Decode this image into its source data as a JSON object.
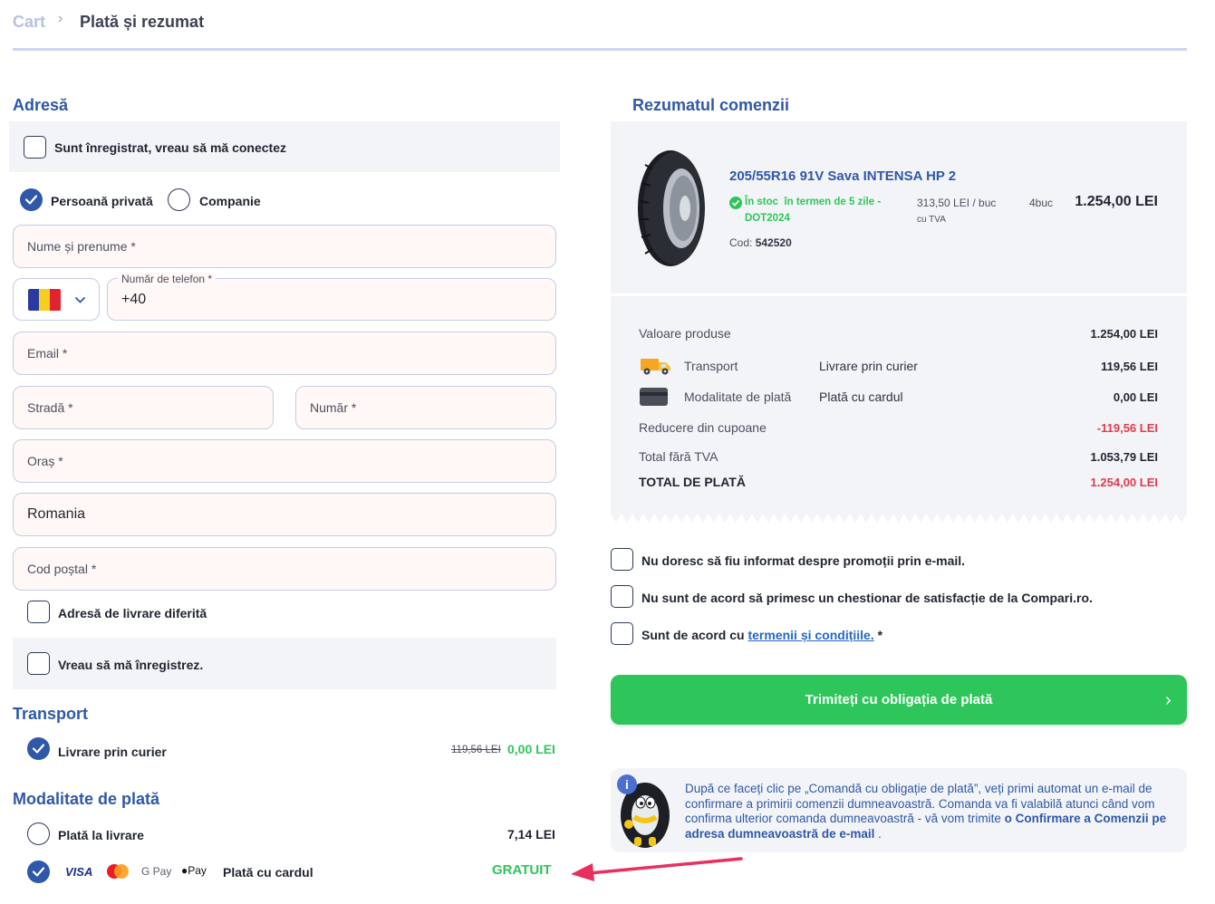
{
  "breadcrumb": {
    "cart": "Cart",
    "separator": "›",
    "current": "Plată și rezumat"
  },
  "address": {
    "title": "Adresă",
    "login_label": "Sunt înregistrat, vreau să mă conectez",
    "private_label": "Persoană privată",
    "company_label": "Companie",
    "name_placeholder": "Nume și prenume *",
    "phone_label": "Număr de telefon *",
    "phone_value": "+40",
    "email_placeholder": "Email *",
    "street_placeholder": "Stradă *",
    "number_placeholder": "Număr *",
    "city_placeholder": "Oraș *",
    "country_value": "Romania",
    "postal_placeholder": "Cod poștal *",
    "different_delivery_label": "Adresă de livrare diferită",
    "register_label": "Vreau să mă înregistrez."
  },
  "transport": {
    "title": "Transport",
    "option_label": "Livrare prin curier",
    "old_price": "119,56 LEI",
    "new_price": "0,00 LEI"
  },
  "payment": {
    "title": "Modalitate de plată",
    "cash_label": "Plată la livrare",
    "cash_price": "7,14 LEI",
    "card_label": "Plată cu cardul",
    "card_price": "GRATUIT",
    "logos": {
      "visa": "VISA",
      "gpay": "G Pay",
      "applepay": "Pay"
    }
  },
  "summary": {
    "title": "Rezumatul comenzii",
    "product": {
      "name": "205/55R16 91V Sava INTENSA HP 2",
      "stock_line1": "În stoc  în termen de 5 zile -",
      "stock_line2": "DOT2024",
      "unit_price": "313,50 LEI / buc",
      "vat_note": "cu TVA",
      "quantity": "4buc",
      "total": "1.254,00 LEI",
      "code_label": "Cod:",
      "code_value": "542520"
    },
    "rows": {
      "products_label": "Valoare produse",
      "products_value": "1.254,00 LEI",
      "transport_label": "Transport",
      "transport_mid": "Livrare prin curier",
      "transport_value": "119,56 LEI",
      "payment_label": "Modalitate de plată",
      "payment_mid": "Plată cu cardul",
      "payment_value": "0,00 LEI",
      "discount_label": "Reducere din cupoane",
      "discount_value": "-119,56 LEI",
      "net_label": "Total fără TVA",
      "net_value": "1.053,79 LEI",
      "total_label": "TOTAL DE PLATĂ",
      "total_value": "1.254,00 LEI"
    }
  },
  "consents": {
    "no_promo": "Nu doresc să fiu informat despre promoții prin e-mail.",
    "no_survey": "Nu sunt de acord să primesc un chestionar de satisfacție de la Compari.ro.",
    "terms_prefix": "Sunt de acord cu",
    "terms_link": "termenii și condițiile.",
    "terms_required": "*"
  },
  "submit": {
    "label": "Trimiteți cu obligația de plată",
    "chevron": "›"
  },
  "info": {
    "text_part1": "După ce faceți clic pe „Comandă cu obligație de plată”, veți primi automat un e-mail de confirmare a primirii comenzii dumneavoastră. Comanda va fi valabilă atunci când vom confirma ulterior comanda dumneavoastră - vă vom trimite",
    "text_bold": "o Confirmare a Comenzii pe adresa dumneavoastră de e-mail",
    "text_end": "."
  },
  "colors": {
    "accent": "#2f58a8",
    "green": "#2ec65a",
    "red": "#e23a4a",
    "arrow": "#e8305f"
  }
}
